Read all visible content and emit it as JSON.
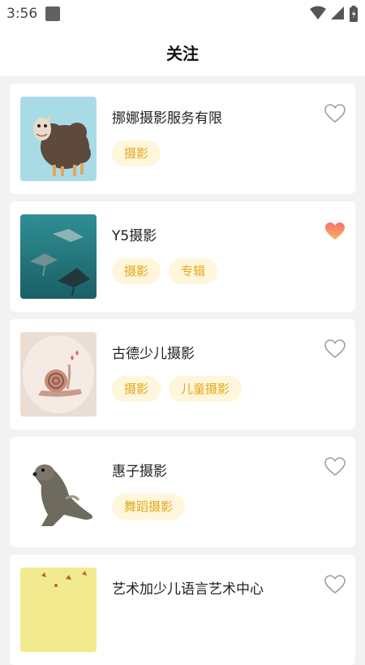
{
  "status_bar": {
    "time": "3:56"
  },
  "header": {
    "title": "关注"
  },
  "accent_colors": {
    "tag_text": "#e4a81c",
    "tag_bg": "#fff6db",
    "heart_active": "#f7726a"
  },
  "studios": [
    {
      "name": "挪娜摄影服务有限",
      "tags": [
        "摄影"
      ],
      "favorited": false,
      "thumbnail_icon": "sheep-illustration"
    },
    {
      "name": "Y5摄影",
      "tags": [
        "摄影",
        "专辑"
      ],
      "favorited": true,
      "thumbnail_icon": "manta-ray-illustration"
    },
    {
      "name": "古德少儿摄影",
      "tags": [
        "摄影",
        "儿童摄影"
      ],
      "favorited": false,
      "thumbnail_icon": "snail-illustration"
    },
    {
      "name": "惠子摄影",
      "tags": [
        "舞蹈摄影"
      ],
      "favorited": false,
      "thumbnail_icon": "sea-lion-illustration"
    },
    {
      "name": "艺术加少儿语言艺术中心",
      "tags": [],
      "favorited": false,
      "thumbnail_icon": "leaves-illustration"
    }
  ]
}
